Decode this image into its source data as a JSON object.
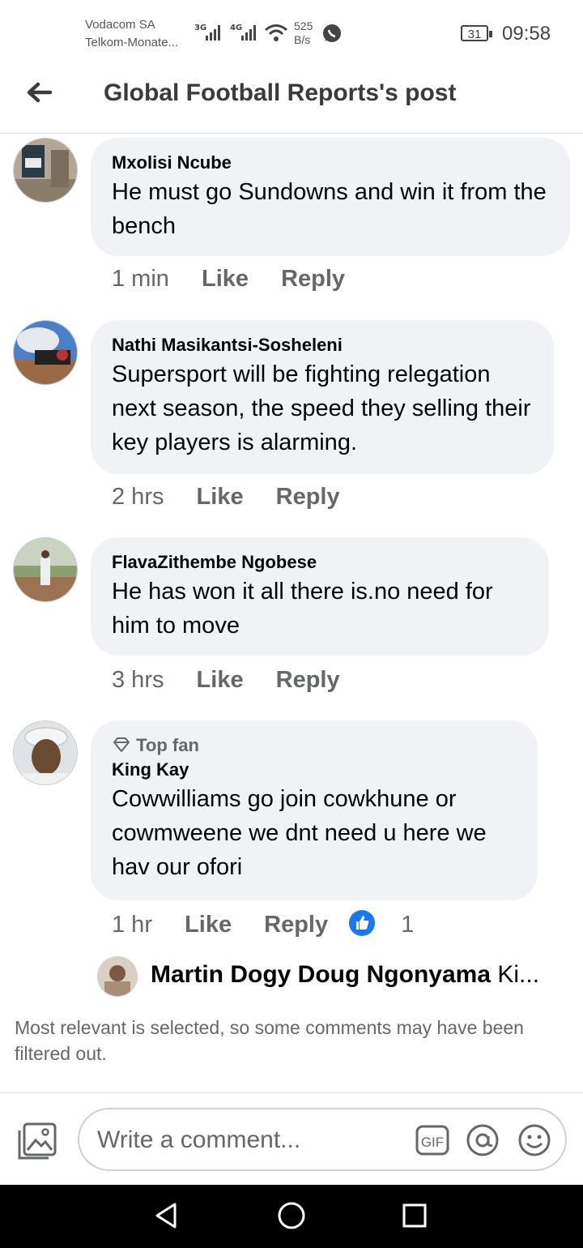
{
  "status_bar": {
    "carrier_1": "Vodacom SA",
    "carrier_2": "Telkom-Monate...",
    "net_speed_value": "525",
    "net_speed_unit": "B/s",
    "battery": "31",
    "time": "09:58"
  },
  "header": {
    "title": "Global Football Reports's post"
  },
  "comments": [
    {
      "author": "Mxolisi Ncube",
      "text": "He must go Sundowns and win it from the bench",
      "time": "1 min",
      "like_label": "Like",
      "reply_label": "Reply"
    },
    {
      "author": "Nathi Masikantsi-Sosheleni",
      "text": "Supersport will be fighting relegation next season, the speed they selling their key players is alarming.",
      "time": "2 hrs",
      "like_label": "Like",
      "reply_label": "Reply"
    },
    {
      "author": "FlavaZithembe Ngobese",
      "text": "He has won it all there is.no need for him to move",
      "time": "3 hrs",
      "like_label": "Like",
      "reply_label": "Reply"
    },
    {
      "badge": "Top fan",
      "author": "King Kay",
      "text": "Cowwilliams go  join cowkhune or cowmweene we dnt need u here we hav our ofori",
      "time": "1 hr",
      "like_label": "Like",
      "reply_label": "Reply",
      "reaction_count": "1"
    }
  ],
  "reply_preview": {
    "author": "Martin Dogy Doug Ngonyama",
    "text": "Ki..."
  },
  "filter_note": "Most relevant is selected, so some comments may have been filtered out.",
  "composer": {
    "placeholder": "Write a comment...",
    "gif_label": "GIF"
  },
  "colors": {
    "bubble": "#f0f2f5",
    "meta": "#65676b",
    "like_blue": "#1877f2"
  }
}
